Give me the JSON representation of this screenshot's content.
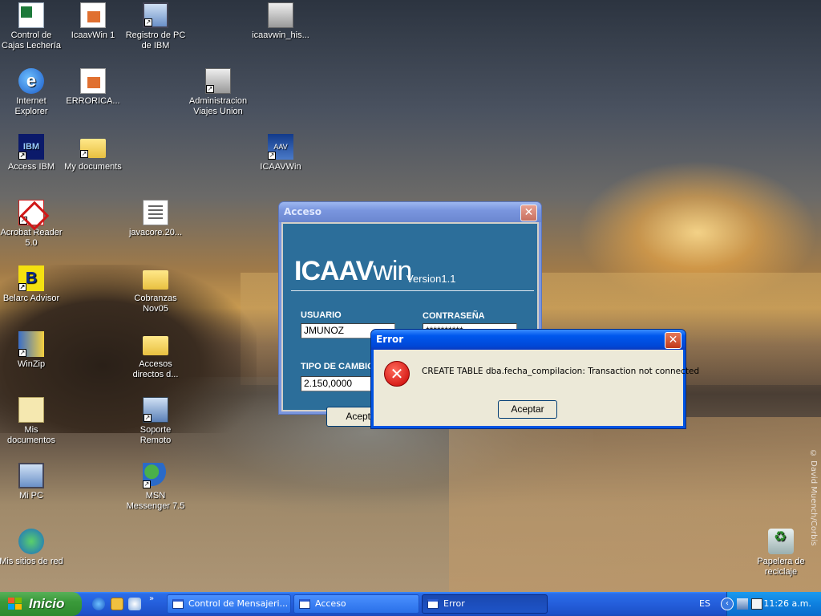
{
  "desktop": {
    "icons": [
      {
        "label": "Control de Cajas Lechería"
      },
      {
        "label": "IcaavWin 1"
      },
      {
        "label": "Registro de PC de IBM"
      },
      {
        "label": "icaavwin_his..."
      },
      {
        "label": "Internet Explorer"
      },
      {
        "label": "ERRORICA..."
      },
      {
        "label": "Administracion Viajes Union"
      },
      {
        "label": "Access IBM"
      },
      {
        "label": "My documents"
      },
      {
        "label": "ICAAVWin"
      },
      {
        "label": "Acrobat Reader 5.0"
      },
      {
        "label": "javacore.20..."
      },
      {
        "label": "Belarc Advisor"
      },
      {
        "label": "Cobranzas Nov05"
      },
      {
        "label": "WinZip"
      },
      {
        "label": "Accesos directos d..."
      },
      {
        "label": "Mis documentos"
      },
      {
        "label": "Soporte Remoto"
      },
      {
        "label": "Mi PC"
      },
      {
        "label": "MSN Messenger 7.5"
      },
      {
        "label": "Mis sitios de red"
      },
      {
        "label": "Papelera de reciclaje"
      }
    ],
    "credit": "© David Muench/Corbis"
  },
  "acceso_window": {
    "title": "Acceso",
    "brand_bold": "ICAAV",
    "brand_thin": "win",
    "version": "Version1.1",
    "usuario_label": "USUARIO",
    "usuario_value": "JMUNOZ",
    "password_label": "CONTRASEÑA",
    "password_value": "**********",
    "tipo_cambio_label": "TIPO DE CAMBIO",
    "tipo_cambio_value": "2.150,0000",
    "accept_label": "Aceptar"
  },
  "error_dialog": {
    "title": "Error",
    "message": "CREATE TABLE dba.fecha_compilacion: Transaction not connected",
    "ok_label": "Aceptar"
  },
  "taskbar": {
    "start_label": "Inicio",
    "tasks": [
      {
        "label": "Control de Mensajeri..."
      },
      {
        "label": "Acceso"
      },
      {
        "label": "Error"
      }
    ],
    "language": "ES",
    "clock": "11:26 a.m."
  }
}
